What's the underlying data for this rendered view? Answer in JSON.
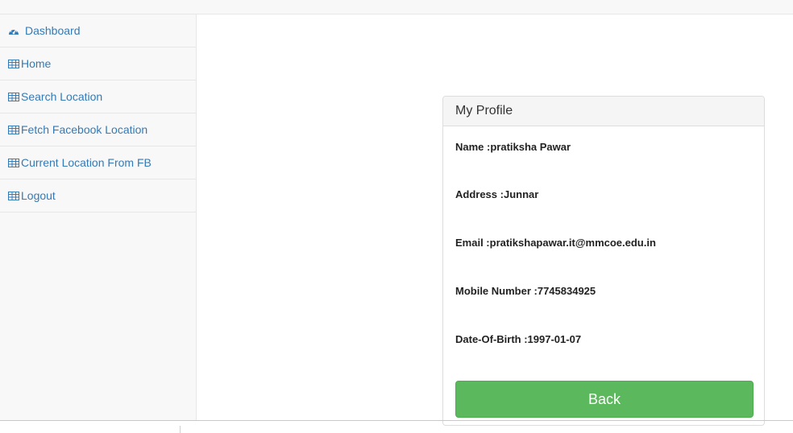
{
  "sidebar": {
    "items": [
      {
        "label": "Dashboard",
        "icon": "dashboard-icon"
      },
      {
        "label": "Home",
        "icon": "table-icon"
      },
      {
        "label": "Search Location",
        "icon": "table-icon"
      },
      {
        "label": "Fetch Facebook Location",
        "icon": "table-icon"
      },
      {
        "label": "Current Location From FB",
        "icon": "table-icon"
      },
      {
        "label": "Logout",
        "icon": "table-icon"
      }
    ]
  },
  "profile": {
    "title": "My Profile",
    "name": "Name :pratiksha Pawar",
    "address": "Address :Junnar",
    "email": "Email :pratikshapawar.it@mmcoe.edu.in",
    "mobile": "Mobile Number :7745834925",
    "dob": "Date-Of-Birth :1997-01-07",
    "back_label": "Back"
  },
  "colors": {
    "link": "#337ab7",
    "button": "#5cb85c",
    "sidebar_bg": "#f8f8f8"
  }
}
